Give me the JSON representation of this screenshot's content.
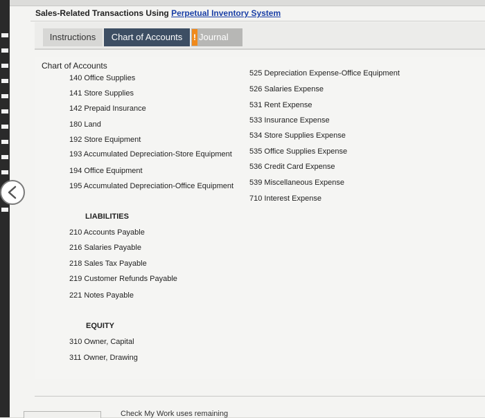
{
  "header": {
    "title_prefix": "Sales-Related Transactions Using ",
    "title_link": "Perpetual Inventory System"
  },
  "tabs": {
    "instructions": "Instructions",
    "chart_of_accounts": "Chart of Accounts",
    "journal_warning": "!",
    "journal": "Journal"
  },
  "chart_of_accounts": {
    "heading": "Chart of Accounts",
    "assets_left": [
      "140 Office Supplies",
      "141 Store Supplies",
      "142 Prepaid Insurance",
      "180 Land",
      "192 Store Equipment",
      "193 Accumulated Depreciation-Store Equipment",
      "194 Office Equipment",
      "195 Accumulated Depreciation-Office Equipment"
    ],
    "liabilities_heading": "LIABILITIES",
    "liabilities": [
      "210 Accounts Payable",
      "216 Salaries Payable",
      "218 Sales Tax Payable",
      "219 Customer Refunds Payable",
      "221 Notes Payable"
    ],
    "equity_heading": "EQUITY",
    "equity": [
      "310 Owner, Capital",
      "311 Owner, Drawing"
    ],
    "expenses": [
      "525 Depreciation Expense-Office Equipment",
      "526 Salaries Expense",
      "531 Rent Expense",
      "533 Insurance Expense",
      "534 Store Supplies Expense",
      "535 Office Supplies Expense",
      "536 Credit Card Expense",
      "539 Miscellaneous Expense",
      "710 Interest Expense"
    ]
  },
  "footer": {
    "text": "Check My Work uses remaining"
  },
  "icons": {
    "back": "chevron-left-icon"
  }
}
